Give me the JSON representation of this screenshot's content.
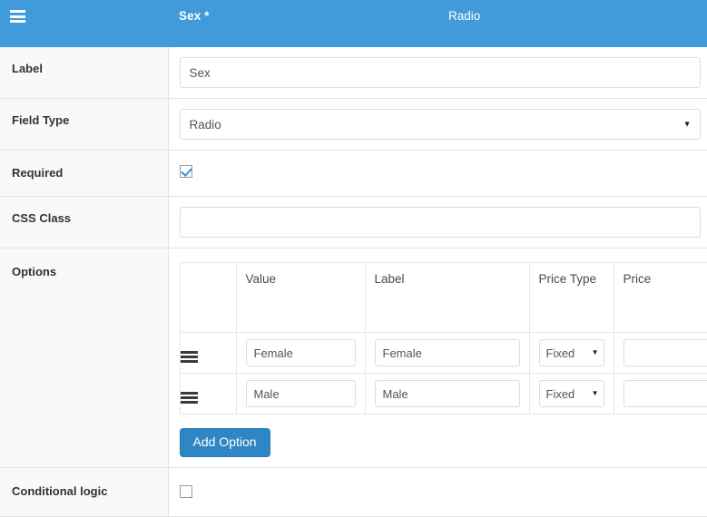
{
  "topbar": {
    "menu_icon": "hamburger-menu-icon",
    "title": "Sex *",
    "subtitle": "Radio",
    "background_color": "#419bda"
  },
  "form": {
    "rows": [
      {
        "label": "Label",
        "type": "text",
        "value": "Sex"
      },
      {
        "label": "Field Type",
        "type": "select",
        "value": "Radio"
      },
      {
        "label": "Required",
        "type": "checkbox",
        "checked": true
      },
      {
        "label": "CSS Class",
        "type": "text",
        "value": ""
      },
      {
        "label": "Options",
        "type": "table"
      },
      {
        "label": "Conditional logic",
        "type": "checkbox",
        "checked": false
      }
    ],
    "label_text": "Label",
    "label_value": "Sex",
    "label_placeholder": "",
    "fieldtype_text": "Field Type",
    "fieldtype_value": "Radio",
    "required_text": "Required",
    "cssclass_text": "CSS Class",
    "cssclass_value": "",
    "cssclass_placeholder": "",
    "options_text": "Options",
    "conditional_text": "Conditional logic"
  },
  "options_table": {
    "headers": [
      "",
      "Value",
      "Label",
      "Price Type",
      "Price",
      ""
    ],
    "header_handle": "",
    "header_value": "Value",
    "header_label": "Label",
    "header_price_type": "Price Type",
    "header_price": "Price",
    "header_trash": "",
    "rows": [
      {
        "handle_icon": "drag-handle-icon",
        "value": "Female",
        "label": "Female",
        "price_type": "Fixed",
        "price": "",
        "delete_icon": "trash-icon"
      },
      {
        "handle_icon": "drag-handle-icon",
        "value": "Male",
        "label": "Male",
        "price_type": "Fixed",
        "price": "",
        "delete_icon": "trash-icon"
      }
    ],
    "add_button_label": "Add Option",
    "add_button_color": "#2e87c4",
    "delete_icon_color": "#2c7cb5"
  }
}
